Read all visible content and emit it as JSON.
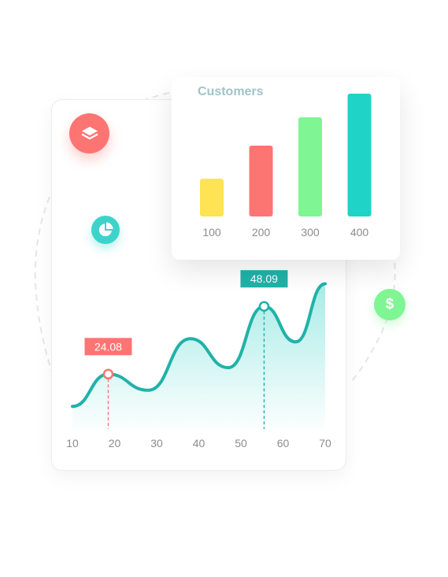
{
  "colors": {
    "teal": "#20b2a8",
    "teal_light": "#3dd3cb",
    "coral": "#fc7572",
    "yellow": "#fee353",
    "green": "#7ff594",
    "axis_text": "#8c8c8c",
    "title": "#9fc4c7"
  },
  "icons": {
    "layers": "layers-icon",
    "pie": "pie-chart-icon",
    "dollar": "dollar-icon",
    "dollar_glyph": "$"
  },
  "chart_data": [
    {
      "type": "bar",
      "title": "Customers",
      "categories": [
        "100",
        "200",
        "300",
        "400"
      ],
      "values": [
        16,
        30,
        42,
        52
      ],
      "ylim": [
        0,
        55
      ],
      "colors": [
        "#fee353",
        "#fc7572",
        "#7ff594",
        "#1fd3c6"
      ],
      "grid": false
    },
    {
      "type": "area",
      "x": [
        10,
        18.5,
        28,
        38,
        47,
        55.5,
        63,
        70
      ],
      "y": [
        7,
        17,
        12,
        28,
        19,
        38,
        27,
        45
      ],
      "xticks": [
        "10",
        "20",
        "30",
        "40",
        "50",
        "60",
        "70"
      ],
      "xlim": [
        10,
        70
      ],
      "ylim": [
        0,
        50
      ],
      "annotations": [
        {
          "x": 18.5,
          "y": 17,
          "label": "24.08",
          "color": "#fc7572"
        },
        {
          "x": 55.5,
          "y": 38,
          "label": "48.09",
          "color": "#20b2a8"
        }
      ],
      "grid": false
    }
  ]
}
